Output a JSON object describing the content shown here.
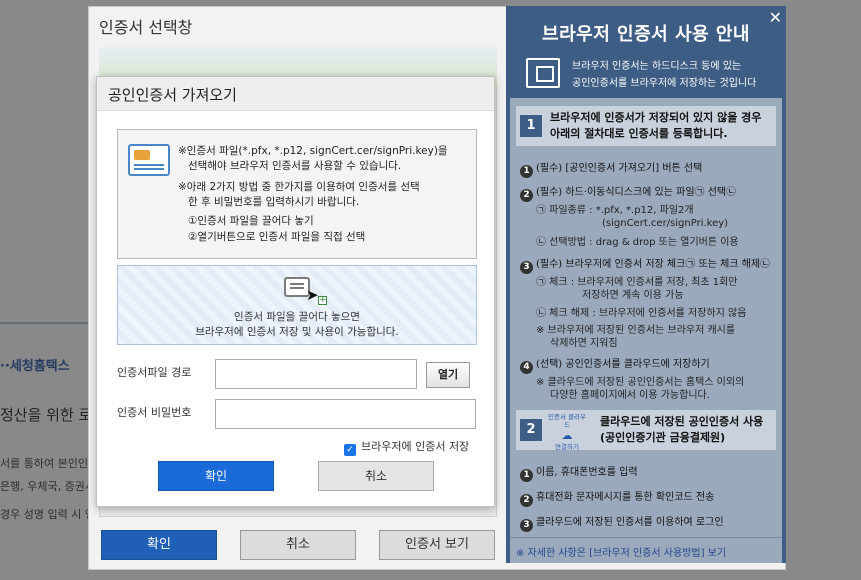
{
  "background_page": {
    "text1": "··세청홈택스",
    "text2": "정산을 위한 로",
    "text3": "서를 통하여 본인인",
    "text4": "은행, 우체국, 증권시",
    "text5": "경우 성명 입력 시 영"
  },
  "cert_window": {
    "title": "인증서 선택창",
    "confirm_label": "확인",
    "cancel_label": "취소",
    "view_cert_label": "인증서 보기"
  },
  "guide": {
    "title": "브라우저 인증서 사용 안내",
    "close_symbol": "✕",
    "intro_line1": "브라우저 인증서는 하드디스크 등에 있는",
    "intro_line2": "공인인증서를 브라우저에 저장하는 것입니다",
    "section1": {
      "number": "1",
      "line1": "브라우저에 인증서가 저장되어 있지 않을 경우",
      "line2": "아래의 절차대로 인증서를 등록합니다."
    },
    "step1": {
      "num": "1",
      "text": "(필수) [공인인증서 가져오기] 버튼 선택"
    },
    "step2": {
      "num": "2",
      "text": "(필수) 하드·이동식디스크에 있는 파일㉠ 선택㉡",
      "sub1_line1": "㉠ 파일종류 : *.pfx, *.p12, 파일2개",
      "sub1_line2": "(signCert.cer/signPri.key)",
      "sub2": "㉡ 선택방법 : drag & drop 또는 열기버튼 이용"
    },
    "step3": {
      "num": "3",
      "text": "(필수) 브라우저에 인증서 저장 체크㉠ 또는 체크 해제㉡",
      "sub1_line1": "㉠ 체크 :  브라우저에 인증서를 저장, 최초 1회만",
      "sub1_line2": "저장하면 계속 이용 가능",
      "sub2": "㉡ 체크 해제 : 브라우저에 인증서를 저장하지 않음",
      "sub3_line1": "※ 브라우저에 저장된 인증서는 브라우저 캐시를",
      "sub3_line2": "삭제하면 지워짐"
    },
    "step4": {
      "num": "4",
      "text": "(선택) 공인인증서를 클라우드에 저장하기",
      "sub1_line1": "※ 클라우드에 저장된 공인인증서는 홈택스 이외의",
      "sub1_line2": "다양한 홈페이지에서 이용 가능합니다."
    },
    "section2": {
      "number": "2",
      "icon_label_top": "인증서 클라우드",
      "icon_label_bottom": "연결하기",
      "line1": "클라우드에 저장된 공인인증서 사용",
      "line2": "(공인인증기관 금융결제원)"
    },
    "cloud_step1": {
      "num": "1",
      "text": "이름, 휴대폰번호를 입력"
    },
    "cloud_step2": {
      "num": "2",
      "text": "휴대전화 문자메시지를 통한 확인코드 전송"
    },
    "cloud_step3": {
      "num": "3",
      "text": "클라우드에 저장된 인증서를 이용하여 로그인"
    },
    "footer": "※ 자세한 사항은 [브라우저 인증서 사용방법] 보기"
  },
  "modal": {
    "title": "공인인증서 가져오기",
    "info_line1": "※인증서 파일(*.pfx, *.p12, signCert.cer/signPri.key)을",
    "info_line2": "선택해야 브라우저 인증서를 사용할 수 있습니다.",
    "info_line3": "※아래 2가지 방법 중 한가지를 이용하여 인증서를 선택",
    "info_line4": "한 후 비밀번호를 입력하시기 바랍니다.",
    "info_line5": "①인증서 파일을 끌어다 놓기",
    "info_line6": "②열기버튼으로 인증서 파일을 직접 선택",
    "drop_line1": "인증서 파일을 끌어다 놓으면",
    "drop_line2": "브라우저에 인증서 저장 및 사용이 가능합니다.",
    "path_label": "인증서파일 경로",
    "path_value": "",
    "open_label": "열기",
    "password_label": "인증서 비밀번호",
    "password_value": "",
    "save_checkbox_label": "브라우저에 인증서 저장",
    "save_checkbox_checked": true,
    "confirm_label": "확인",
    "cancel_label": "취소"
  }
}
